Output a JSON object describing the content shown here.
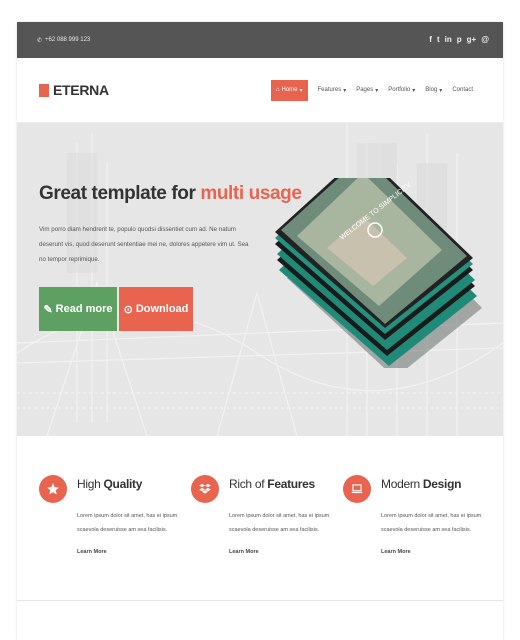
{
  "topbar": {
    "phone": "+62 088 999 123",
    "social_icons": [
      "facebook-icon",
      "twitter-icon",
      "linkedin-icon",
      "pinterest-icon",
      "google-plus-icon",
      "dribbble-icon"
    ],
    "social_glyphs": [
      "f",
      "t",
      "in",
      "p",
      "g+",
      "@"
    ]
  },
  "header": {
    "logo_text": "ETERNA",
    "nav": [
      {
        "label": "Home",
        "active": true
      },
      {
        "label": "Features"
      },
      {
        "label": "Pages"
      },
      {
        "label": "Portfolio"
      },
      {
        "label": "Blog"
      },
      {
        "label": "Contact"
      }
    ]
  },
  "hero": {
    "title_plain": "Great template for ",
    "title_accent": "multi usage",
    "text": "Vim porro diam hendrerit te, populo quodsi dissentiet cum ad. Ne natum deserunt vis, quod deserunt sententiae mei ne, dolores appetere vim ut. Sea no tempor reprimique.",
    "btn_read_more": "Read more",
    "btn_download": "Download",
    "mock_text": "WELCOME TO SIMPLICITY"
  },
  "features": [
    {
      "title_light": "High ",
      "title_bold": "Quality",
      "text": "Lorem ipsum dolor sit amet, has ei ipsum scaevola deseruisse am sea facilisis.",
      "link": "Learn More",
      "icon": "star-icon"
    },
    {
      "title_light": "Rich of ",
      "title_bold": "Features",
      "text": "Lorem ipsum dolor sit amet, has ei ipsum scaevola deseruisse am sea facilisis.",
      "link": "Learn More",
      "icon": "dropbox-icon"
    },
    {
      "title_light": "Modern ",
      "title_bold": "Design",
      "text": "Lorem ipsum dolor sit amet, has ei ipsum scaevola deseruisse am sea facilisis.",
      "link": "Learn More",
      "icon": "laptop-icon"
    }
  ],
  "colors": {
    "accent": "#e8644f",
    "green": "#5ea062",
    "topbar": "#555555"
  }
}
